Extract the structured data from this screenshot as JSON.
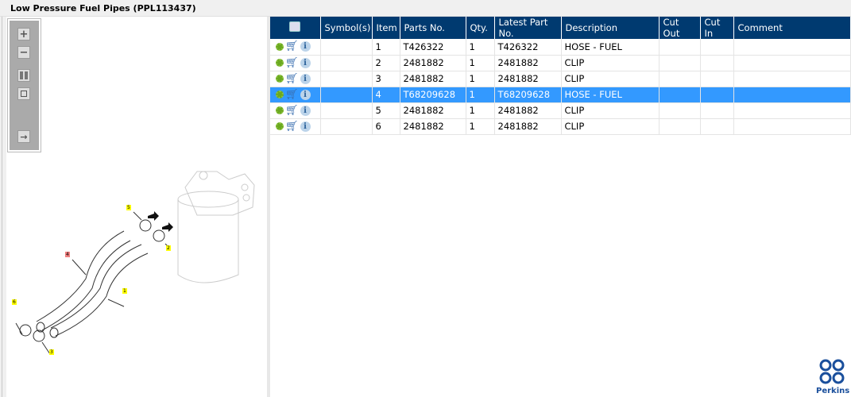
{
  "window": {
    "title": "Low Pressure Fuel Pipes (PPL113437)"
  },
  "toolbar": {
    "zoom_in": "+",
    "zoom_out": "−"
  },
  "grid": {
    "columns": [
      "Symbol(s)",
      "Item",
      "Parts No.",
      "Qty.",
      "Latest Part No.",
      "Description",
      "Cut Out",
      "Cut In",
      "Comment"
    ],
    "rows": [
      {
        "item": "1",
        "part": "T426322",
        "qty": "1",
        "latest": "T426322",
        "desc": "HOSE - FUEL"
      },
      {
        "item": "2",
        "part": "2481882",
        "qty": "1",
        "latest": "2481882",
        "desc": "CLIP"
      },
      {
        "item": "3",
        "part": "2481882",
        "qty": "1",
        "latest": "2481882",
        "desc": "CLIP"
      },
      {
        "item": "4",
        "part": "T68209628",
        "qty": "1",
        "latest": "T68209628",
        "desc": "HOSE - FUEL"
      },
      {
        "item": "5",
        "part": "2481882",
        "qty": "1",
        "latest": "2481882",
        "desc": "CLIP"
      },
      {
        "item": "6",
        "part": "2481882",
        "qty": "1",
        "latest": "2481882",
        "desc": "CLIP"
      }
    ],
    "selected_item": "4"
  },
  "diagram": {
    "callouts": [
      "1",
      "2",
      "3",
      "4",
      "5",
      "6"
    ],
    "highlighted": "4"
  },
  "brand": {
    "name": "Perkins",
    "color": "#1a4f9c"
  }
}
